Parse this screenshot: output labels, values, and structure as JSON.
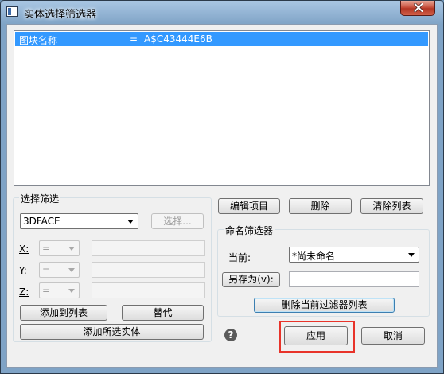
{
  "window": {
    "title": "实体选择筛选器",
    "close_icon": "close-icon",
    "app_icon": "window-icon"
  },
  "filter_list": {
    "rows": [
      {
        "name": "图块名称",
        "op": "=",
        "value": "A$C43444E6B"
      }
    ]
  },
  "top_buttons": {
    "edit": "编辑项目",
    "delete": "删除",
    "clear": "清除列表"
  },
  "select_filter": {
    "label": "选择筛选",
    "type_value": "3DFACE",
    "select_button": "选择...",
    "x_label": "X:",
    "y_label": "Y:",
    "z_label": "Z:",
    "x_op": "=",
    "y_op": "=",
    "z_op": "=",
    "add_to_list": "添加到列表",
    "replace": "替代",
    "add_selected": "添加所选实体"
  },
  "named_filters": {
    "label": "命名筛选器",
    "current_label": "当前:",
    "current_value": "*尚未命名",
    "save_as": "另存为(v):",
    "save_as_value": "",
    "delete_filter": "删除当前过滤器列表"
  },
  "bottom": {
    "apply": "应用",
    "cancel": "取消",
    "help_icon": "help-icon",
    "help_glyph": "?"
  },
  "colors": {
    "selection": "#3399ff",
    "highlight": "#e8332a"
  }
}
